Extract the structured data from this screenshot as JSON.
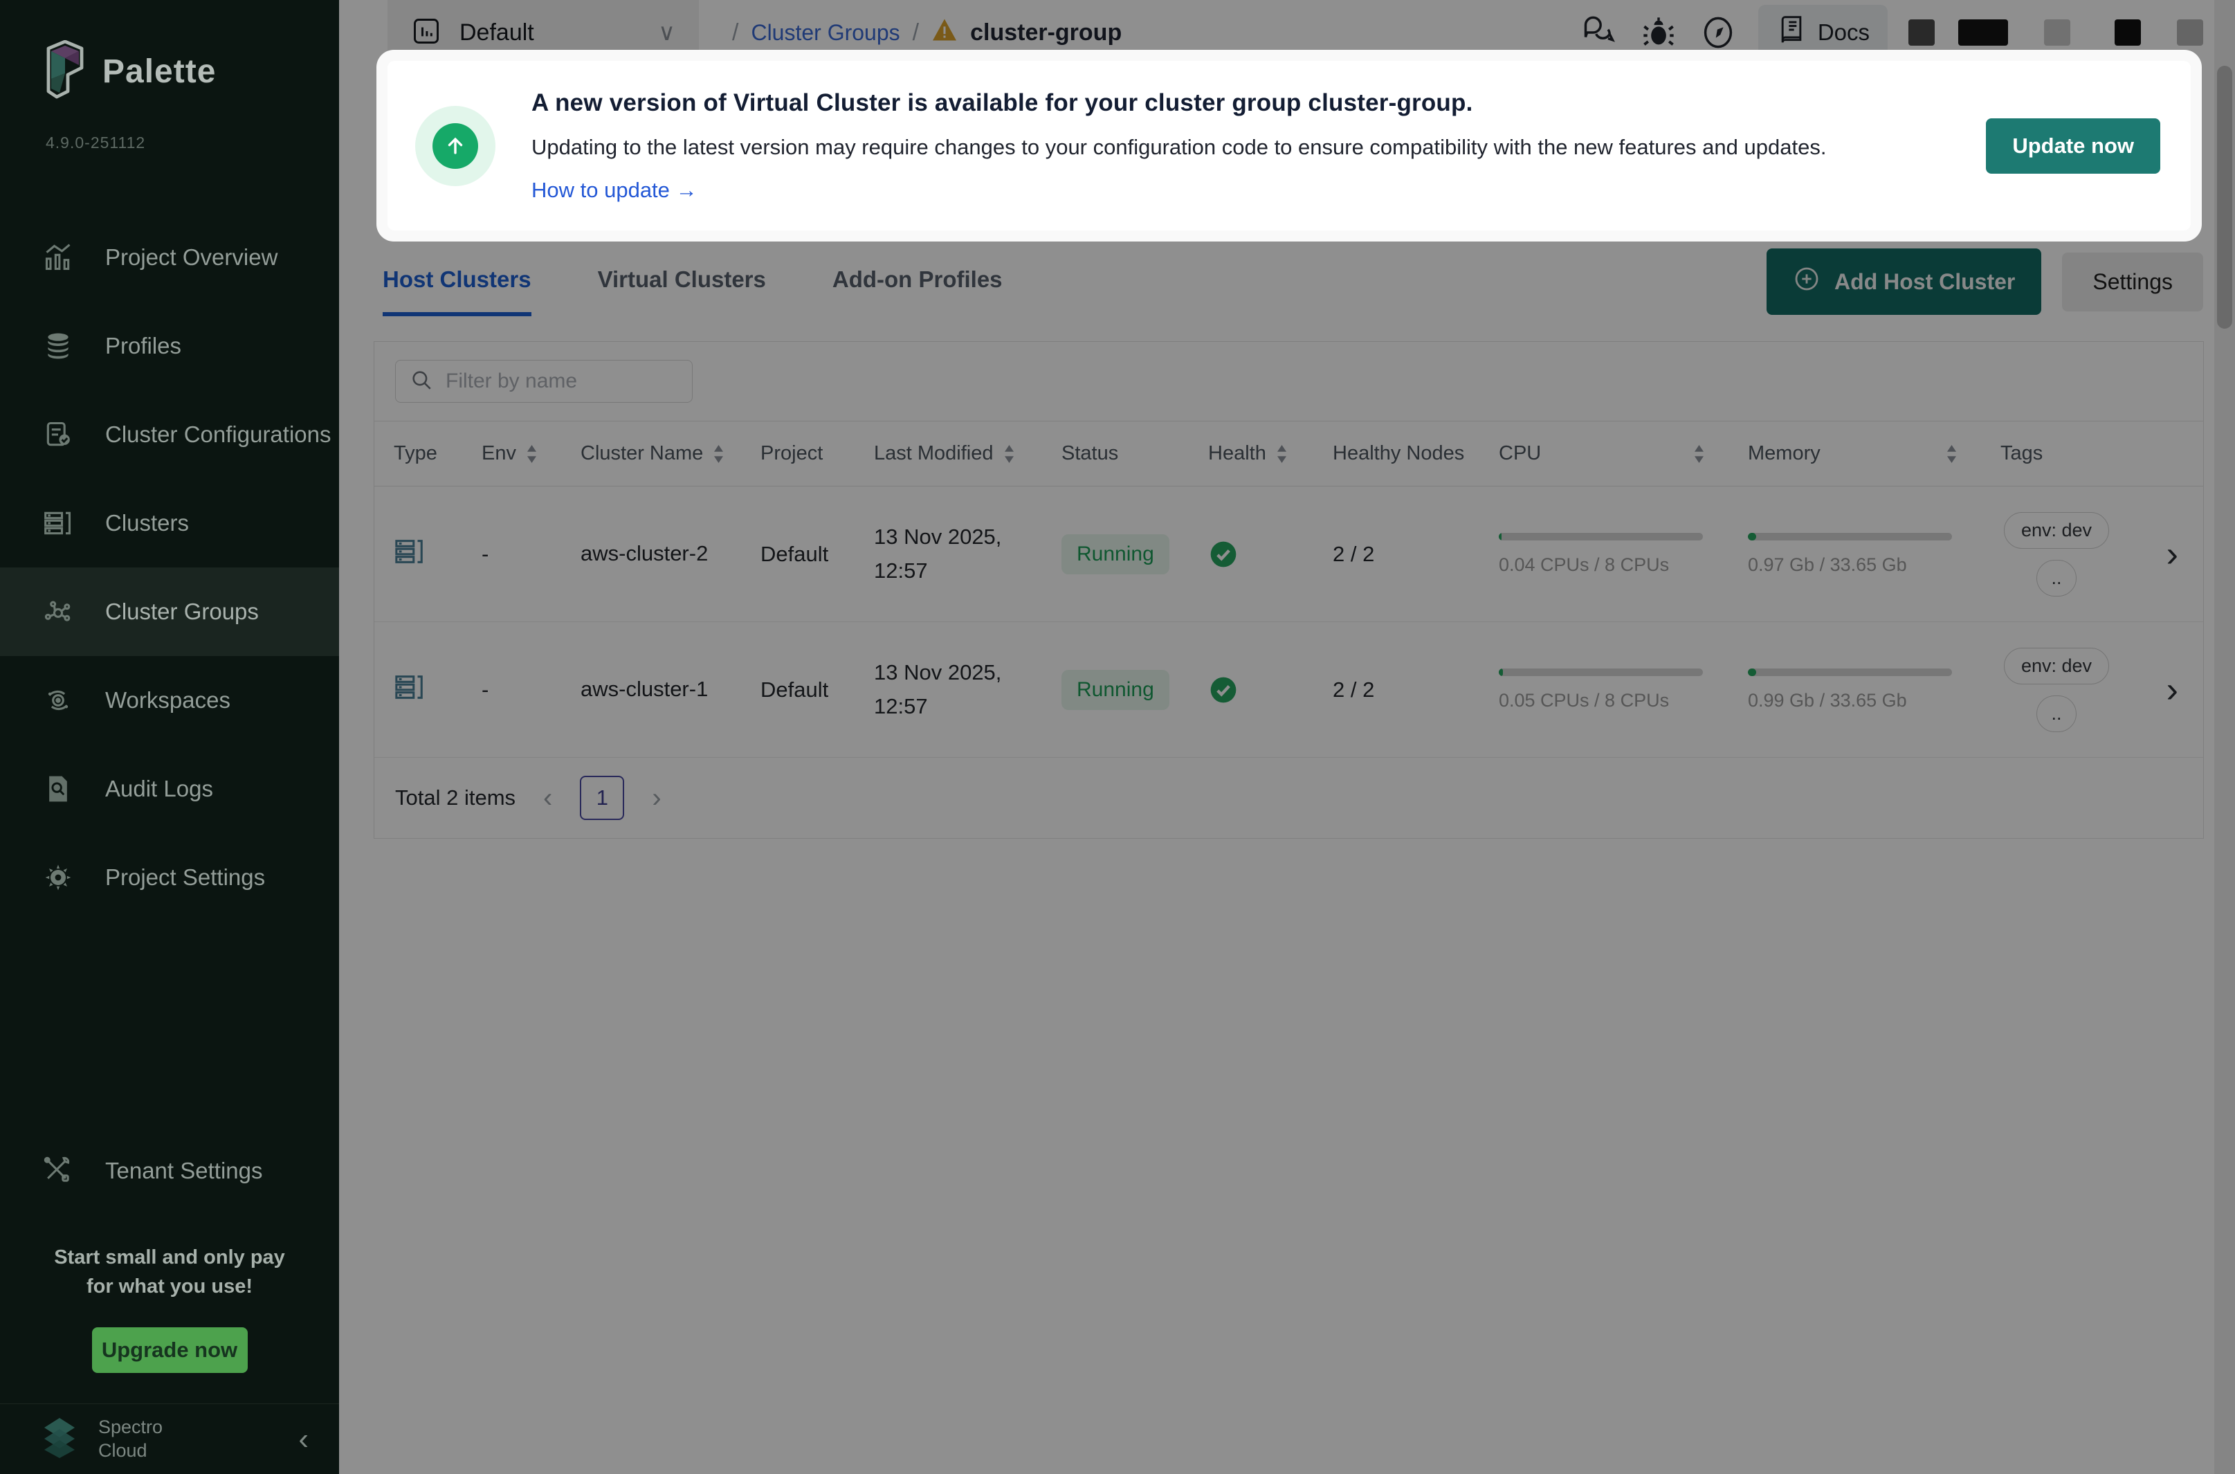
{
  "sidebar": {
    "logo_text": "Palette",
    "version": "4.9.0-251112",
    "items": [
      {
        "label": "Project Overview"
      },
      {
        "label": "Profiles"
      },
      {
        "label": "Cluster Configurations"
      },
      {
        "label": "Clusters"
      },
      {
        "label": "Cluster Groups"
      },
      {
        "label": "Workspaces"
      },
      {
        "label": "Audit Logs"
      },
      {
        "label": "Project Settings"
      }
    ],
    "tenant_settings_label": "Tenant Settings",
    "promo_line1": "Start small and only pay",
    "promo_line2": "for what you use!",
    "upgrade_button": "Upgrade now",
    "brand_line1": "Spectro",
    "brand_line2": "Cloud"
  },
  "topbar": {
    "project_selector": "Default",
    "breadcrumb_root": "Cluster Groups",
    "breadcrumb_current": "cluster-group",
    "docs_label": "Docs"
  },
  "banner": {
    "title": "A new version of Virtual Cluster is available for your cluster group cluster-group.",
    "body": "Updating to the latest version may require changes to your configuration code to ensure compatibility with the new features and updates.",
    "link": "How to update →",
    "button": "Update now"
  },
  "tabs": [
    {
      "label": "Host Clusters"
    },
    {
      "label": "Virtual Clusters"
    },
    {
      "label": "Add-on Profiles"
    }
  ],
  "actions": {
    "add_host_cluster": "Add Host Cluster",
    "settings": "Settings"
  },
  "table": {
    "filter_placeholder": "Filter by name",
    "columns": [
      {
        "label": "Type"
      },
      {
        "label": "Env"
      },
      {
        "label": "Cluster Name"
      },
      {
        "label": "Project"
      },
      {
        "label": "Last Modified"
      },
      {
        "label": "Status"
      },
      {
        "label": "Health"
      },
      {
        "label": "Healthy Nodes"
      },
      {
        "label": "CPU"
      },
      {
        "label": "Memory"
      },
      {
        "label": "Tags"
      }
    ],
    "rows": [
      {
        "env": "-",
        "name": "aws-cluster-2",
        "project": "Default",
        "modified_line1": "13 Nov 2025,",
        "modified_line2": "12:57",
        "status": "Running",
        "healthy_nodes": "2 / 2",
        "cpu_text": "0.04 CPUs / 8 CPUs",
        "cpu_pct": 1.5,
        "mem_text": "0.97 Gb / 33.65 Gb",
        "mem_pct": 4,
        "tag": "env: dev",
        "tag_more": ".."
      },
      {
        "env": "-",
        "name": "aws-cluster-1",
        "project": "Default",
        "modified_line1": "13 Nov 2025,",
        "modified_line2": "12:57",
        "status": "Running",
        "healthy_nodes": "2 / 2",
        "cpu_text": "0.05 CPUs / 8 CPUs",
        "cpu_pct": 2,
        "mem_text": "0.99 Gb / 33.65 Gb",
        "mem_pct": 4.2,
        "tag": "env: dev",
        "tag_more": ".."
      }
    ],
    "footer": {
      "total": "Total 2 items",
      "page": "1"
    }
  }
}
